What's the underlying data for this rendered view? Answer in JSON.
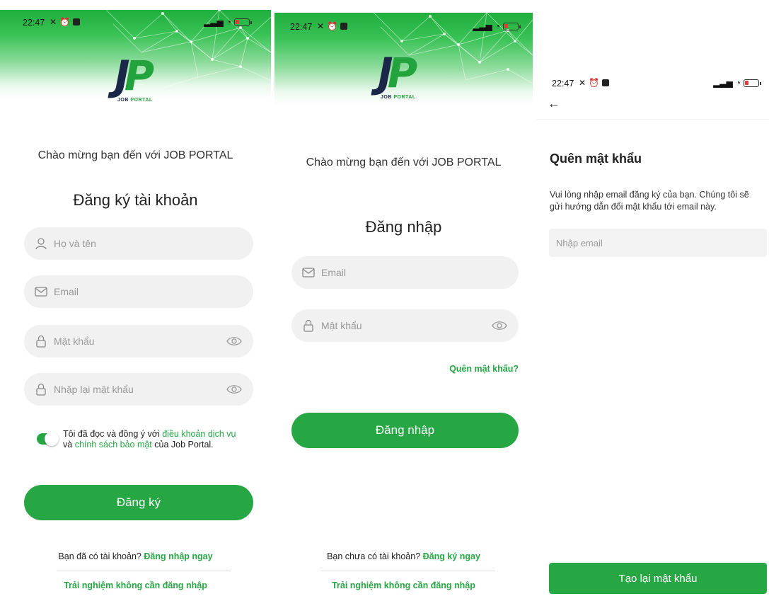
{
  "status": {
    "time": "22:47",
    "left_icons": [
      "mute-icon",
      "alarm-icon",
      "app-icon"
    ],
    "right_icons": [
      "signal-icon",
      "wifi-icon",
      "battery-icon"
    ]
  },
  "brand": {
    "logo_letters": "JP",
    "logo_j": "J",
    "logo_p": "P",
    "logo_text_a": "JOB",
    "logo_text_b": "PORTAL",
    "green": "#26a744",
    "navy": "#1a2748"
  },
  "register": {
    "welcome": "Chào mừng bạn đến với JOB PORTAL",
    "title": "Đăng ký tài khoản",
    "name_placeholder": "Họ và tên",
    "email_placeholder": "Email",
    "password_placeholder": "Mật khẩu",
    "confirm_placeholder": "Nhập lại mật khẩu",
    "terms_part1": "Tôi đã đọc và đồng ý với ",
    "terms_link1": "điều khoản dịch vụ",
    "terms_part2": "và ",
    "terms_link2": "chính sách bảo mật",
    "terms_part3": " của Job Portal.",
    "terms_accepted": true,
    "submit_label": "Đăng ký",
    "have_account": "Bạn đã có tài khoản? ",
    "login_link": "Đăng nhập ngay",
    "guest_link": "Trải nghiệm không cần đăng nhập"
  },
  "login": {
    "welcome": "Chào mừng bạn đến với JOB PORTAL",
    "title": "Đăng nhập",
    "email_placeholder": "Email",
    "password_placeholder": "Mật khẩu",
    "forgot_link": "Quên mật khẩu?",
    "submit_label": "Đăng nhập",
    "no_account": "Bạn chưa có tài khoản? ",
    "register_link": "Đăng ký ngay",
    "guest_link": "Trải nghiệm không cần đăng nhập"
  },
  "forgot": {
    "title": "Quên mật khẩu",
    "description": "Vui lòng nhập email đăng ký của bạn. Chúng tôi sẽ gửi hướng dẫn đổi mật khẩu tới email này.",
    "email_placeholder": "Nhập email",
    "submit_label": "Tạo lại mật khẩu"
  }
}
